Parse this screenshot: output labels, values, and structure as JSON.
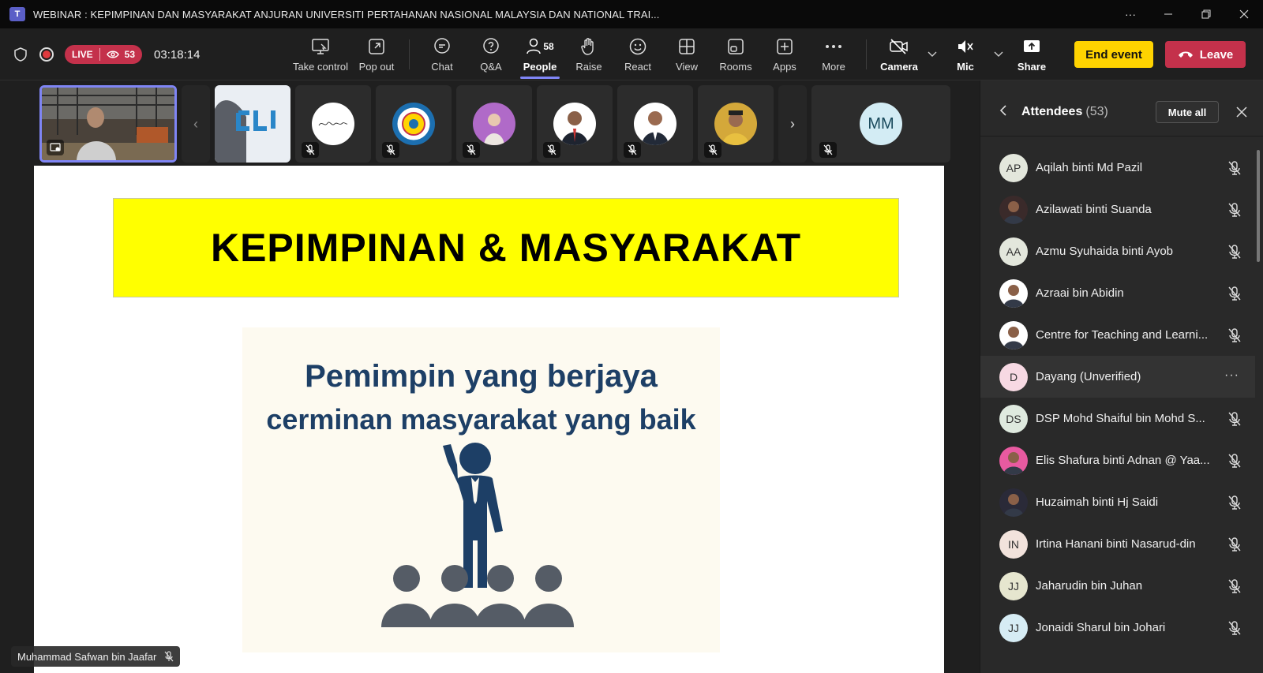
{
  "window": {
    "title": "WEBINAR : KEPIMPINAN DAN MASYARAKAT ANJURAN UNIVERSITI PERTAHANAN NASIONAL MALAYSIA DAN NATIONAL TRAI...",
    "app_icon": "T"
  },
  "status": {
    "live_label": "LIVE",
    "viewers": "53",
    "elapsed": "03:18:14"
  },
  "toolbar": {
    "take_control": "Take control",
    "pop_out": "Pop out",
    "chat": "Chat",
    "qa": "Q&A",
    "people": "People",
    "people_count": "58",
    "raise": "Raise",
    "react": "React",
    "view": "View",
    "rooms": "Rooms",
    "apps": "Apps",
    "more": "More",
    "camera": "Camera",
    "mic": "Mic",
    "share": "Share",
    "end_event": "End event",
    "leave": "Leave"
  },
  "strip": {
    "mm_initials": "MM"
  },
  "slide": {
    "banner": "KEPIMPINAN & MASYARAKAT",
    "line1": "Pemimpin yang berjaya",
    "line2": "cerminan masyarakat yang baik"
  },
  "presenter_name": "Muhammad Safwan bin Jaafar",
  "panel": {
    "title": "Attendees",
    "count": "(53)",
    "mute_all": "Mute all",
    "attendees": [
      {
        "initials": "AP",
        "name": "Aqilah binti Md Pazil",
        "color": "#e3e7dc"
      },
      {
        "initials": "",
        "name": "Azilawati binti Suanda",
        "color": "#3a2a2a"
      },
      {
        "initials": "AA",
        "name": "Azmu Syuhaida binti Ayob",
        "color": "#e3e7dc"
      },
      {
        "initials": "",
        "name": "Azraai bin Abidin",
        "color": "#ffffff"
      },
      {
        "initials": "",
        "name": "Centre for Teaching and Learni...",
        "color": "#ffffff"
      },
      {
        "initials": "D",
        "name": "Dayang (Unverified)",
        "color": "#f7d9e3"
      },
      {
        "initials": "DS",
        "name": "DSP Mohd Shaiful bin Mohd S...",
        "color": "#dfeadf"
      },
      {
        "initials": "",
        "name": "Elis Shafura binti Adnan @ Yaa...",
        "color": "#e85aa0"
      },
      {
        "initials": "",
        "name": "Huzaimah binti Hj Saidi",
        "color": "#2a2a38"
      },
      {
        "initials": "IN",
        "name": "Irtina Hanani binti Nasarud-din",
        "color": "#f2e3dc"
      },
      {
        "initials": "JJ",
        "name": "Jaharudin bin Juhan",
        "color": "#e6e6cf"
      },
      {
        "initials": "JJ",
        "name": "Jonaidi Sharul bin Johari",
        "color": "#d6ecf4"
      }
    ]
  }
}
